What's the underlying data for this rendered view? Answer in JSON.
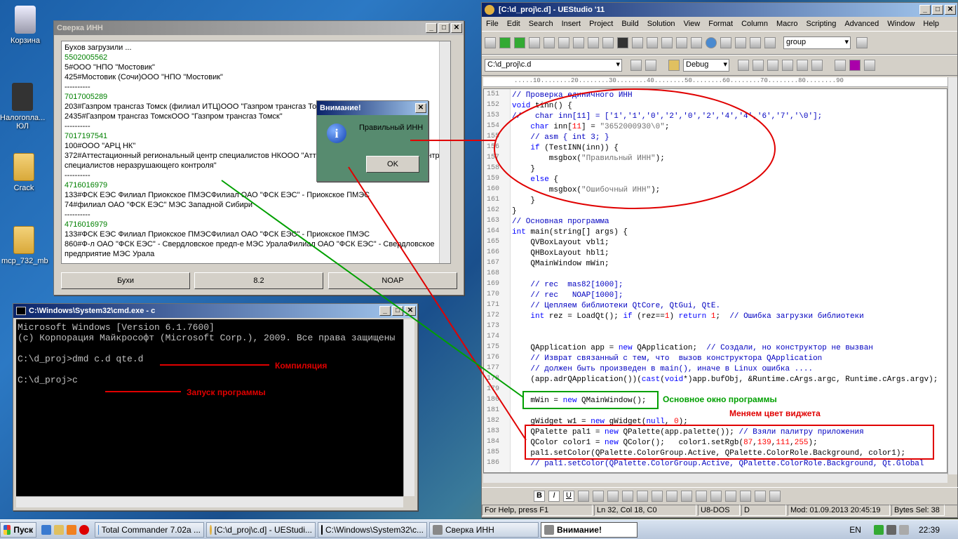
{
  "desktop": {
    "icons": [
      {
        "label": "Корзина"
      },
      {
        "label": "Налогопла... ЮЛ"
      },
      {
        "label": "Crack"
      },
      {
        "label": "mcp_732_mb"
      }
    ]
  },
  "sverka": {
    "title": "Сверка ИНН",
    "lines": [
      {
        "t": "Бухов загрузили ...",
        "c": "black"
      },
      {
        "t": "5502005562",
        "c": "green"
      },
      {
        "t": "5#ООО \"НПО \"Мостовик\"",
        "c": "black"
      },
      {
        "t": "425#Мостовик (Сочи)ООО \"НПО \"Мостовик\"",
        "c": "black"
      },
      {
        "t": "----------",
        "c": "black"
      },
      {
        "t": "7017005289",
        "c": "green"
      },
      {
        "t": "203#Газпром трансгаз Томск (филиал ИТЦ)ООО \"Газпром трансгаз Томск\"",
        "c": "black"
      },
      {
        "t": "2435#Газпром трансгаз ТомскООО \"Газпром трансгаз Томск\"",
        "c": "black"
      },
      {
        "t": "----------",
        "c": "black"
      },
      {
        "t": "7017197541",
        "c": "green"
      },
      {
        "t": "100#ООО \"АРЦ НК\"",
        "c": "black"
      },
      {
        "t": "372#Аттестационный региональный центр специалистов НКООО \"Аттестационный региональный центр",
        "c": "black"
      },
      {
        "t": "специалистов неразрушающего контроля\"",
        "c": "black"
      },
      {
        "t": "----------",
        "c": "black"
      },
      {
        "t": "4716016979",
        "c": "green"
      },
      {
        "t": "133#ФСК ЕЭС Филиал Приокское ПМЭСФилиал ОАО \"ФСК ЕЭС\" - Приокское ПМЭС",
        "c": "black"
      },
      {
        "t": "74#филиал ОАО \"ФСК ЕЭС\" МЭС Западной Сибири",
        "c": "black"
      },
      {
        "t": "----------",
        "c": "black"
      },
      {
        "t": "4716016979",
        "c": "green"
      },
      {
        "t": "133#ФСК ЕЭС Филиал Приокское ПМЭСФилиал ОАО \"ФСК ЕЭС\" - Приокское ПМЭС",
        "c": "black"
      },
      {
        "t": "860#Ф-л ОАО \"ФСК ЕЭС\" - Свердловское предп-е МЭС УралаФилиал ОАО \"ФСК ЕЭС\" - Свердловское",
        "c": "black"
      },
      {
        "t": "предприятие МЭС Урала",
        "c": "black"
      }
    ],
    "buttons": [
      "Бухи",
      "8.2",
      "NOAP"
    ]
  },
  "msgbox": {
    "title": "Внимание!",
    "text": "Правильный ИНН",
    "ok": "OK"
  },
  "cmd": {
    "title": "C:\\Windows\\System32\\cmd.exe - c",
    "lines": [
      "Microsoft Windows [Version 6.1.7600]",
      "(c) Корпорация Майкрософт (Microsoft Corp.), 2009. Все права защищены",
      "",
      "C:\\d_proj>dmd c.d qte.d",
      "",
      "C:\\d_proj>c"
    ]
  },
  "annotations": {
    "compile": "Компиляция",
    "run": "Запуск программы",
    "mainwin": "Основное окно программы",
    "widget": "Меняем цвет виджета"
  },
  "ue": {
    "title": "[C:\\d_proj\\c.d] - UEStudio '11",
    "menu": [
      "File",
      "Edit",
      "Search",
      "Insert",
      "Project",
      "Build",
      "Solution",
      "View",
      "Format",
      "Column",
      "Macro",
      "Scripting",
      "Advanced",
      "Window",
      "Help"
    ],
    "search_combo": "group",
    "file_combo": "C:\\d_proj\\c.d",
    "config_combo": "Debug",
    "status": {
      "help": "For Help, press F1",
      "pos": "Ln 32, Col 18, C0",
      "enc": "U8-DOS",
      "mode": "D",
      "mod": "Mod: 01.09.2013 20:45:19",
      "bytes": "Bytes Sel: 38"
    }
  },
  "code": [
    {
      "n": "151",
      "h": "<span class='cm'>// Проверка единичного ИНН</span>"
    },
    {
      "n": "152",
      "h": "<span class='kw'>void</span> tinn() {"
    },
    {
      "n": "153",
      "h": "<span class='cm'>//   char inn[11] = ['1','1','0','2','0','2','4','4','6','7','\\0'];</span>"
    },
    {
      "n": "154",
      "h": "    <span class='kw'>char</span> inn[<span class='nm'>11</span>] = <span class='st'>\"3652000930\\0\"</span>;"
    },
    {
      "n": "155",
      "h": "    <span class='cm'>// asm { int 3; }</span>"
    },
    {
      "n": "156",
      "h": "    <span class='kw'>if</span> (TestINN(inn)) {"
    },
    {
      "n": "157",
      "h": "        msgbox(<span class='st'>\"Правильный ИНН\"</span>);"
    },
    {
      "n": "158",
      "h": "    }"
    },
    {
      "n": "159",
      "h": "    <span class='kw'>else</span> {"
    },
    {
      "n": "160",
      "h": "        msgbox(<span class='st'>\"Ошибочный ИНН\"</span>);"
    },
    {
      "n": "161",
      "h": "    }"
    },
    {
      "n": "162",
      "h": "}"
    },
    {
      "n": "163",
      "h": "<span class='cm'>// Основная программа</span>"
    },
    {
      "n": "164",
      "h": "<span class='kw'>int</span> main(string[] args) {"
    },
    {
      "n": "165",
      "h": "    QVBoxLayout vbl1;"
    },
    {
      "n": "166",
      "h": "    QHBoxLayout hbl1;"
    },
    {
      "n": "167",
      "h": "    QMainWindow mWin;"
    },
    {
      "n": "168",
      "h": ""
    },
    {
      "n": "169",
      "h": "    <span class='cm'>// rec  mas82[1000];</span>"
    },
    {
      "n": "170",
      "h": "    <span class='cm'>// rec   NOAP[1000];</span>"
    },
    {
      "n": "171",
      "h": "    <span class='cm'>// Цепляем библиотеки QtCore, QtGui, QtE.</span>"
    },
    {
      "n": "172",
      "h": "    <span class='kw'>int</span> rez = LoadQt(); <span class='kw'>if</span> (rez==<span class='nm'>1</span>) <span class='kw'>return</span> <span class='nm'>1</span>;  <span class='cm'>// Ошибка загрузки библиотеки</span>"
    },
    {
      "n": "173",
      "h": ""
    },
    {
      "n": "174",
      "h": ""
    },
    {
      "n": "175",
      "h": "    QApplication app = <span class='kw'>new</span> QApplication;  <span class='cm'>// Создали, но конструктор не вызван</span>"
    },
    {
      "n": "176",
      "h": "    <span class='cm'>// Изврат связанный с тем, что  вызов конструктора QApplication</span>"
    },
    {
      "n": "177",
      "h": "    <span class='cm'>// должен быть произведен в main(), иначе в Linux ошибка ....</span>"
    },
    {
      "n": "178",
      "h": "    (app.adrQApplication())(<span class='kw'>cast</span>(<span class='kw'>void</span>*)app.bufObj, &amp;Runtime.cArgs.argc, Runtime.cArgs.argv);"
    },
    {
      "n": "179",
      "h": ""
    },
    {
      "n": "180",
      "h": "    mWin = <span class='kw'>new</span> QMainWindow();"
    },
    {
      "n": "181",
      "h": ""
    },
    {
      "n": "182",
      "h": "    gWidget w1 = <span class='kw'>new</span> gWidget(<span class='kw'>null</span>, <span class='nm'>0</span>);"
    },
    {
      "n": "183",
      "h": "    QPalette pal1 = <span class='kw'>new</span> QPalette(app.palette()); <span class='cm'>// Взяли палитру приложения</span>"
    },
    {
      "n": "184",
      "h": "    QColor color1 = <span class='kw'>new</span> QColor();   color1.setRgb(<span class='nm'>87</span>,<span class='nm'>139</span>,<span class='nm'>111</span>,<span class='nm'>255</span>);"
    },
    {
      "n": "185",
      "h": "    pal1.setColor(QPalette.ColorGroup.Active, QPalette.ColorRole.Background, color1);"
    },
    {
      "n": "186",
      "h": "    <span class='cm'>// pal1.setColor(QPalette.ColorGroup.Active, QPalette.ColorRole.Background, Qt.Global</span>"
    }
  ],
  "taskbar": {
    "start": "Пуск",
    "tasks": [
      "Total Commander 7.02a ...",
      "[C:\\d_proj\\c.d] - UEStudi...",
      "C:\\Windows\\System32\\c...",
      "Сверка ИНН",
      "Внимание!"
    ],
    "lang": "EN",
    "clock": "22:39"
  },
  "colors": {
    "msg_bg": "#578b6f",
    "annot_red": "#e00000",
    "annot_green": "#00a000"
  }
}
